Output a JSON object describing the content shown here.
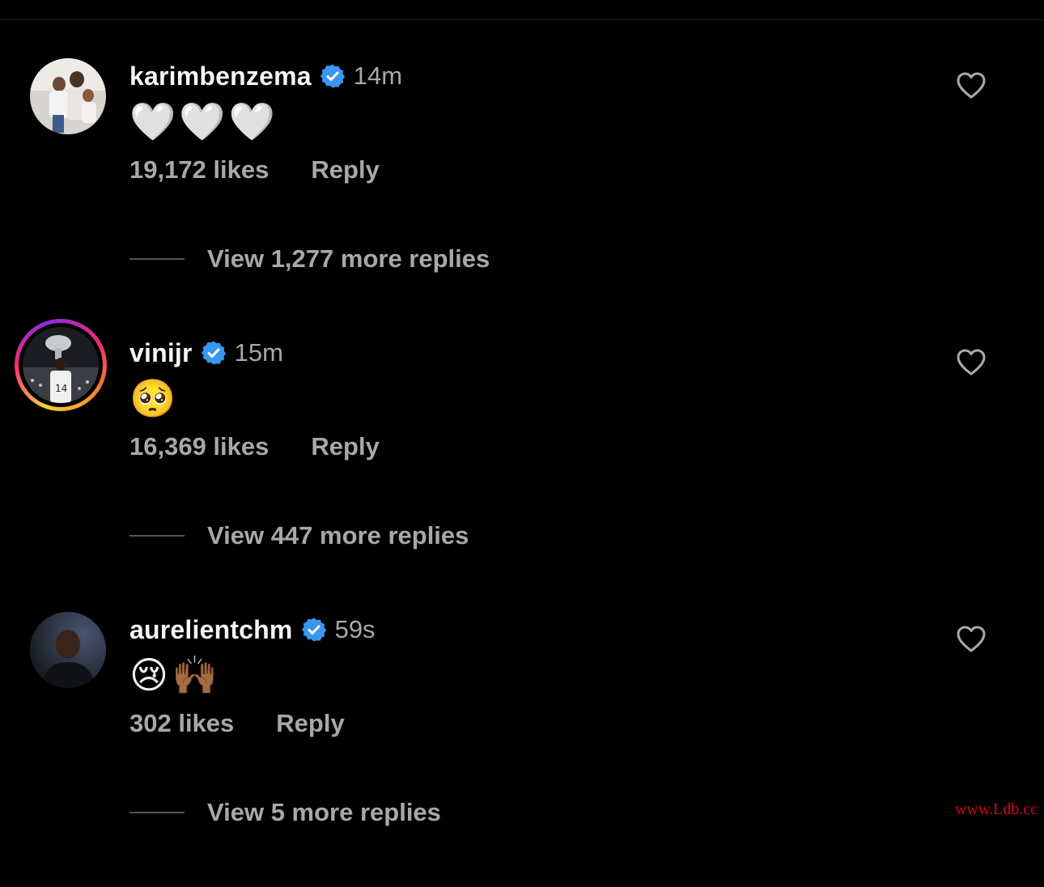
{
  "comments": [
    {
      "username": "karimbenzema",
      "time": "14m",
      "text": "🤍🤍🤍",
      "likes": "19,172 likes",
      "reply_label": "Reply",
      "view_replies": "View 1,277 more replies",
      "has_story": false
    },
    {
      "username": "vinijr",
      "time": "15m",
      "text": "🥺",
      "likes": "16,369 likes",
      "reply_label": "Reply",
      "view_replies": "View 447 more replies",
      "has_story": true
    },
    {
      "username": "aurelientchm",
      "time": "59s",
      "text": "😢🙌🏾",
      "likes": "302 likes",
      "reply_label": "Reply",
      "view_replies": "View 5 more replies",
      "has_story": false
    }
  ],
  "watermark": "www.Ldb.cc",
  "icons": {
    "verified": "verified-badge-icon",
    "like": "heart-outline-icon"
  },
  "colors": {
    "background": "#000000",
    "primary_text": "#f5f5f5",
    "secondary_text": "#a8a8a8",
    "verified_blue": "#3897f0",
    "watermark_red": "#d9001b"
  }
}
